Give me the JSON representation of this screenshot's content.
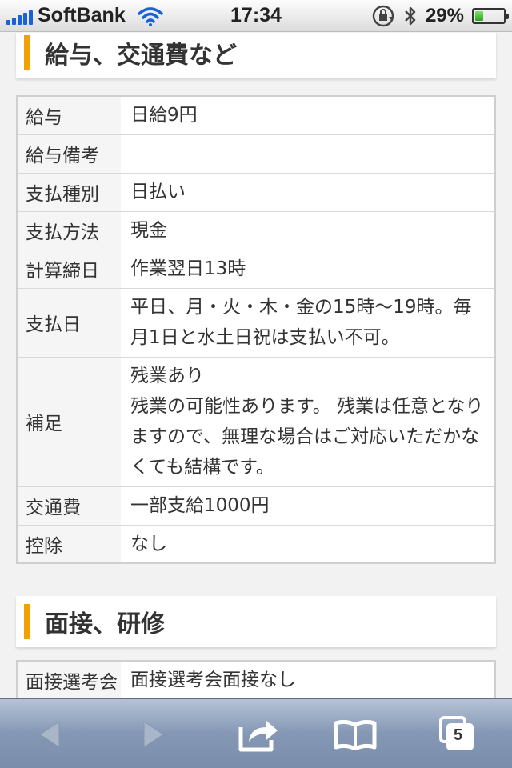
{
  "status_bar": {
    "carrier": "SoftBank",
    "time": "17:34",
    "battery_percent": "29%",
    "battery_level": 0.29,
    "signal_icon": "signal-bars-icon",
    "wifi_icon": "wifi-icon",
    "rotation_lock_icon": "rotation-lock-icon",
    "bluetooth_icon": "bluetooth-icon"
  },
  "colors": {
    "accent": "#f3a100",
    "signal": "#1a63d6"
  },
  "sections": [
    {
      "title": "給与、交通費など",
      "rows": [
        {
          "label": "給与",
          "value": "日給9円"
        },
        {
          "label": "給与備考",
          "value": ""
        },
        {
          "label": "支払種別",
          "value": "日払い"
        },
        {
          "label": "支払方法",
          "value": "現金"
        },
        {
          "label": "計算締日",
          "value": "作業翌日13時"
        },
        {
          "label": "支払日",
          "value": "平日、月・火・木・金の15時〜19時。毎月1日と水土日祝は支払い不可。"
        },
        {
          "label": "補足",
          "value": "残業あり\n残業の可能性あります。 残業は任意となりますので、無理な場合はご対応いただかなくても結構です。"
        },
        {
          "label": "交通費",
          "value": "一部支給1000円"
        },
        {
          "label": "控除",
          "value": "なし"
        }
      ]
    },
    {
      "title": "面接、研修",
      "rows": [
        {
          "label": "面接選考会",
          "value": "面接選考会面接なし"
        }
      ]
    }
  ],
  "toolbar": {
    "back_icon": "back-arrow-icon",
    "forward_icon": "forward-arrow-icon",
    "share_icon": "share-icon",
    "bookmarks_icon": "bookmarks-icon",
    "tabs_icon": "tabs-icon",
    "tabs_count": "5"
  }
}
